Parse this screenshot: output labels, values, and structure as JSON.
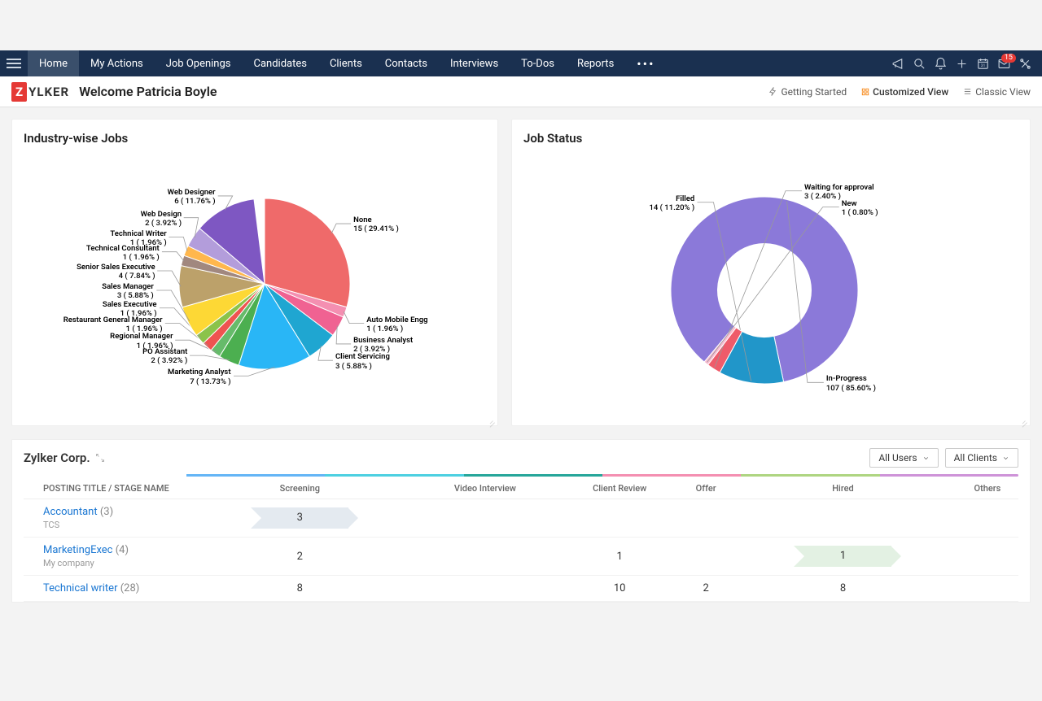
{
  "nav": {
    "items": [
      "Home",
      "My Actions",
      "Job Openings",
      "Candidates",
      "Clients",
      "Contacts",
      "Interviews",
      "To-Dos",
      "Reports"
    ],
    "active_index": 0,
    "mail_badge": "15"
  },
  "brand": {
    "mark": "Z",
    "text": "YLKER"
  },
  "welcome": "Welcome Patricia Boyle",
  "views": {
    "getting_started": "Getting Started",
    "customized": "Customized View",
    "classic": "Classic View"
  },
  "cards": {
    "industry": {
      "title": "Industry-wise Jobs"
    },
    "status": {
      "title": "Job Status"
    }
  },
  "chart_data": [
    {
      "type": "pie",
      "title": "Industry-wise Jobs",
      "series": [
        {
          "name": "None",
          "value": 15,
          "pct": 29.41,
          "color": "#ef6a6a"
        },
        {
          "name": "Auto Mobile Engg",
          "value": 1,
          "pct": 1.96,
          "color": "#f48fb1"
        },
        {
          "name": "Business Analyst",
          "value": 2,
          "pct": 3.92,
          "color": "#f06292"
        },
        {
          "name": "Client Servicing",
          "value": 3,
          "pct": 5.88,
          "color": "#1fa6d1"
        },
        {
          "name": "Marketing Analyst",
          "value": 7,
          "pct": 13.73,
          "color": "#29b6f6"
        },
        {
          "name": "PO Assistant",
          "value": 2,
          "pct": 3.92,
          "color": "#4caf50"
        },
        {
          "name": "Regional Manager",
          "value": 1,
          "pct": 1.96,
          "color": "#66bb6a"
        },
        {
          "name": "Restaurant General Manager",
          "value": 1,
          "pct": 1.96,
          "color": "#ef5350"
        },
        {
          "name": "Sales Executive",
          "value": 1,
          "pct": 1.96,
          "color": "#8bc34a"
        },
        {
          "name": "Sales Manager",
          "value": 3,
          "pct": 5.88,
          "color": "#fdd835"
        },
        {
          "name": "Senior Sales Executive",
          "value": 4,
          "pct": 7.84,
          "color": "#bca16a"
        },
        {
          "name": "Technical Consultant",
          "value": 1,
          "pct": 1.96,
          "color": "#a1887f"
        },
        {
          "name": "Technical Writer",
          "value": 1,
          "pct": 1.96,
          "color": "#ffb74d"
        },
        {
          "name": "Web Design",
          "value": 2,
          "pct": 3.92,
          "color": "#b39ddb"
        },
        {
          "name": "Web Designer",
          "value": 6,
          "pct": 11.76,
          "color": "#7e57c2"
        }
      ]
    },
    {
      "type": "pie",
      "donut": true,
      "title": "Job Status",
      "series": [
        {
          "name": "In-Progress",
          "value": 107,
          "pct": 85.6,
          "color": "#8b79d9"
        },
        {
          "name": "Filled",
          "value": 14,
          "pct": 11.2,
          "color": "#2196c9"
        },
        {
          "name": "Waiting for approval",
          "value": 3,
          "pct": 2.4,
          "color": "#ef5b6a"
        },
        {
          "name": "New",
          "value": 1,
          "pct": 0.8,
          "color": "#f8bbd0"
        }
      ]
    }
  ],
  "pipeline": {
    "title": "Zylker Corp.",
    "filters": {
      "users": "All Users",
      "clients": "All Clients"
    },
    "header_first": "POSTING TITLE / STAGE NAME",
    "stages": [
      "Screening",
      "Video Interview",
      "Client Review",
      "Offer",
      "Hired",
      "Others"
    ],
    "stage_colors": [
      "#64b5f6",
      "#4dd0e1",
      "#26a69a",
      "#f48fb1",
      "#aed581",
      "#ce93d8"
    ],
    "rows": [
      {
        "title": "Accountant",
        "count": 3,
        "company": "TCS",
        "cells": [
          {
            "v": "3",
            "style": "blue"
          },
          null,
          null,
          null,
          null,
          null
        ]
      },
      {
        "title": "MarketingExec",
        "count": 4,
        "company": "My company",
        "cells": [
          {
            "v": "2"
          },
          null,
          {
            "v": "1"
          },
          null,
          {
            "v": "1",
            "style": "green"
          },
          null
        ]
      },
      {
        "title": "Technical writer",
        "count": 28,
        "company": "",
        "cells": [
          {
            "v": "8"
          },
          null,
          {
            "v": "10"
          },
          {
            "v": "2"
          },
          {
            "v": "8"
          },
          null
        ]
      }
    ]
  }
}
